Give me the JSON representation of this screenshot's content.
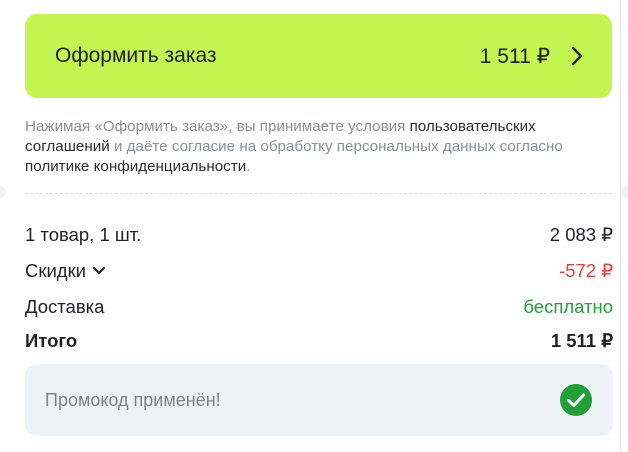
{
  "checkout": {
    "button_label": "Оформить заказ",
    "total": "1 511 ₽",
    "chevron_icon": "chevron-right-icon",
    "color": "#c3f44f"
  },
  "legal": {
    "prefix": "Нажимая «Оформить заказ», вы принимаете условия ",
    "link_agreements": "пользовательских соглашений",
    "middle": " и даёте согласие на обработку персональных данных согласно ",
    "link_privacy": "политике конфиденциальности",
    "suffix": "."
  },
  "summary": {
    "items_label": "1 товар, 1 шт.",
    "items_value": "2 083 ₽",
    "discount_label": "Скидки",
    "discount_value": "-572 ₽",
    "delivery_label": "Доставка",
    "delivery_value": "бесплатно",
    "total_label": "Итого",
    "total_value": "1 511 ₽"
  },
  "promo": {
    "text": "Промокод применён!",
    "status_icon": "check-circle-icon",
    "status_color": "#21a038"
  }
}
